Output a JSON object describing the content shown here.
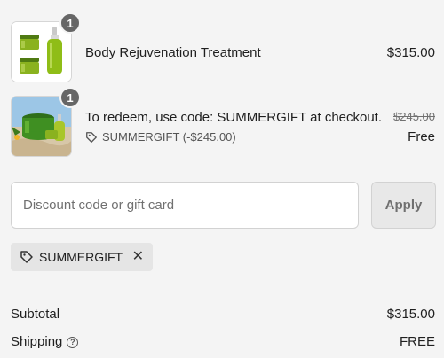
{
  "cart": {
    "items": [
      {
        "quantity": "1",
        "name": "Body Rejuvenation Treatment",
        "price": "$315.00",
        "image_icon": "green-cosmetics-jars-and-dropper-image"
      },
      {
        "quantity": "1",
        "name": "To redeem, use code: SUMMERGIFT at checkout.",
        "original_price": "$245.00",
        "price": "Free",
        "discount_label": "SUMMERGIFT (-$245.00)",
        "image_icon": "green-jars-on-sand-image"
      }
    ]
  },
  "discount": {
    "placeholder": "Discount code or gift card",
    "value": "",
    "apply_label": "Apply",
    "applied_code": "SUMMERGIFT"
  },
  "summary": {
    "subtotal_label": "Subtotal",
    "subtotal_value": "$315.00",
    "shipping_label": "Shipping",
    "shipping_value": "FREE"
  },
  "colors": {
    "background": "#f4f4f4",
    "badge": "#666666",
    "product_green": "#8ab21f"
  }
}
